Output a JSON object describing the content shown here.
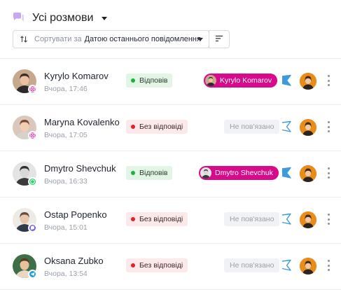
{
  "header": {
    "title": "Усі розмови",
    "title_icon": "chat-bubbles-icon",
    "sort": {
      "prefix": "Сортувати за",
      "value": "Датою останнього повідомлення"
    }
  },
  "colors": {
    "accent": "#d60a8b",
    "replied_bg": "#e3f6e6",
    "replied_dot": "#19b33e",
    "not_replied_bg": "#fde8ea",
    "not_replied_dot": "#e0202c",
    "bot_icon": "#3d9bdc",
    "instagram": "#d6249f",
    "whatsapp": "#25d366",
    "viber": "#7360f2",
    "telegram": "#229ed9"
  },
  "conversations": [
    {
      "name": "Kyrylo Komarov",
      "time": "Вчора, 17:46",
      "channel": "instagram",
      "status": "Відповів",
      "status_type": "replied",
      "assignee": "Kyrylo Komarov",
      "bot_active": true
    },
    {
      "name": "Maryna Kovalenko",
      "time": "Вчора, 17:05",
      "channel": "instagram",
      "status": "Без відповіді",
      "status_type": "not_replied",
      "assignee": "Не пов'язано",
      "bot_active": false
    },
    {
      "name": "Dmytro Shevchuk",
      "time": "Вчора, 16:33",
      "channel": "whatsapp",
      "status": "Відповів",
      "status_type": "replied",
      "assignee": "Dmytro Shevchuk",
      "bot_active": true
    },
    {
      "name": "Ostap Popenko",
      "time": "Вчора, 15:01",
      "channel": "viber",
      "status": "Без відповіді",
      "status_type": "not_replied",
      "assignee": "Не пов'язано",
      "bot_active": false
    },
    {
      "name": "Oksana Zubko",
      "time": "Вчора, 13:54",
      "channel": "telegram",
      "status": "Без відповіді",
      "status_type": "not_replied",
      "assignee": "Не пов'язано",
      "bot_active": false
    }
  ]
}
